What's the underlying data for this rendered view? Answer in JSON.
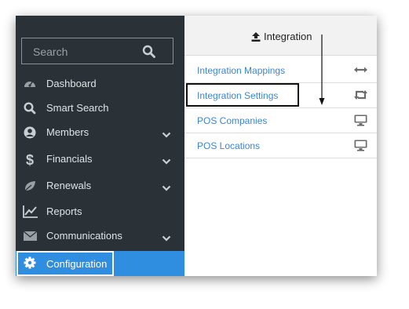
{
  "sidebar": {
    "search_placeholder": "Search",
    "items": [
      {
        "label": "Dashboard",
        "icon": "dashboard-icon",
        "has_chevron": false
      },
      {
        "label": "Smart Search",
        "icon": "search-icon",
        "has_chevron": false
      },
      {
        "label": "Members",
        "icon": "user-circle-icon",
        "has_chevron": true
      },
      {
        "label": "Financials",
        "icon": "dollar-icon",
        "has_chevron": true
      },
      {
        "label": "Renewals",
        "icon": "leaf-icon",
        "has_chevron": true
      },
      {
        "label": "Reports",
        "icon": "line-chart-icon",
        "has_chevron": false
      },
      {
        "label": "Communications",
        "icon": "envelope-icon",
        "has_chevron": true
      },
      {
        "label": "Configuration",
        "icon": "gear-icon",
        "has_chevron": false,
        "active": true
      }
    ]
  },
  "panel": {
    "title": "Integration",
    "items": [
      {
        "label": "Integration Mappings",
        "icon": "arrows-horizontal-icon"
      },
      {
        "label": "Integration Settings",
        "icon": "retweet-icon"
      },
      {
        "label": "POS Companies",
        "icon": "desktop-icon"
      },
      {
        "label": "POS Locations",
        "icon": "desktop-icon"
      }
    ]
  },
  "colors": {
    "sidebar_bg": "#2b3237",
    "active_bg": "#2f8ee0",
    "link": "#3a86d4"
  }
}
